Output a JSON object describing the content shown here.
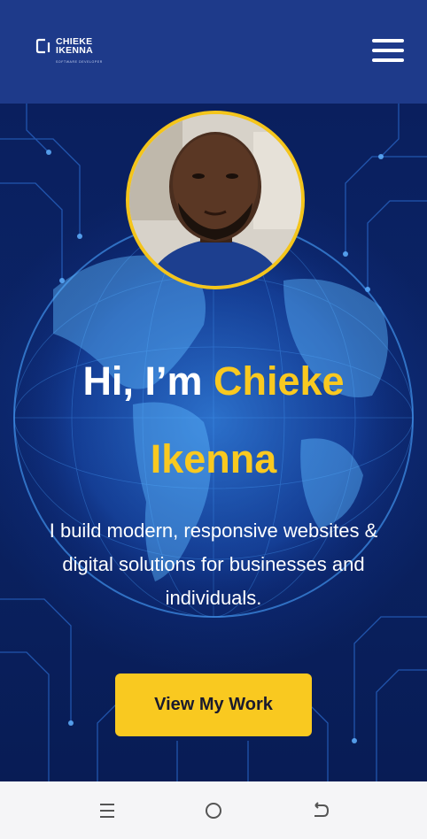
{
  "header": {
    "logo": {
      "line1": "CHIEKE",
      "line2": "IKENNA",
      "tagline": "SOFTWARE DEVELOPER"
    },
    "menu_icon": "hamburger-menu-icon"
  },
  "hero": {
    "greeting": "Hi, I’m ",
    "name_line1": "Chieke",
    "name_line2": "Ikenna",
    "subtitle": "I build modern, responsive websites & digital solutions for businesses and individuals.",
    "cta_label": "View My Work",
    "background": "digital globe with circuit lines",
    "colors": {
      "accent": "#f9c920",
      "header_bg": "#1e3a8a",
      "hero_bg": "#0b2466"
    }
  },
  "system_nav": {
    "recents_icon": "recent-apps-icon",
    "home_icon": "home-icon",
    "back_icon": "back-icon"
  }
}
